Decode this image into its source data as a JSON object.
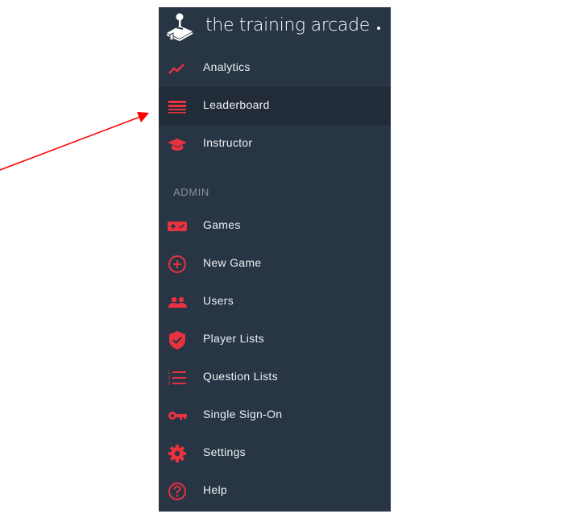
{
  "brand": {
    "name": "the training arcade",
    "logo_icon": "joystick-book-icon"
  },
  "colors": {
    "sidebar_bg": "#283545",
    "active_bg": "#222c39",
    "accent": "#e8323e",
    "text": "#eef0f3",
    "section_text": "#8590a0",
    "annotation_arrow": "#ff0000"
  },
  "nav": {
    "items": [
      {
        "label": "Analytics",
        "icon": "trend-line-icon",
        "active": false
      },
      {
        "label": "Leaderboard",
        "icon": "list-bars-icon",
        "active": true
      },
      {
        "label": "Instructor",
        "icon": "graduation-cap-icon",
        "active": false
      }
    ]
  },
  "admin": {
    "section_label": "ADMIN",
    "items": [
      {
        "label": "Games",
        "icon": "gamepad-icon"
      },
      {
        "label": "New Game",
        "icon": "plus-circle-icon"
      },
      {
        "label": "Users",
        "icon": "users-icon"
      },
      {
        "label": "Player Lists",
        "icon": "shield-check-icon"
      },
      {
        "label": "Question Lists",
        "icon": "numbered-list-icon"
      },
      {
        "label": "Single Sign-On",
        "icon": "key-icon"
      },
      {
        "label": "Settings",
        "icon": "gear-icon"
      },
      {
        "label": "Help",
        "icon": "help-circle-icon"
      }
    ]
  },
  "annotation": {
    "type": "arrow",
    "points_to": "Leaderboard"
  }
}
